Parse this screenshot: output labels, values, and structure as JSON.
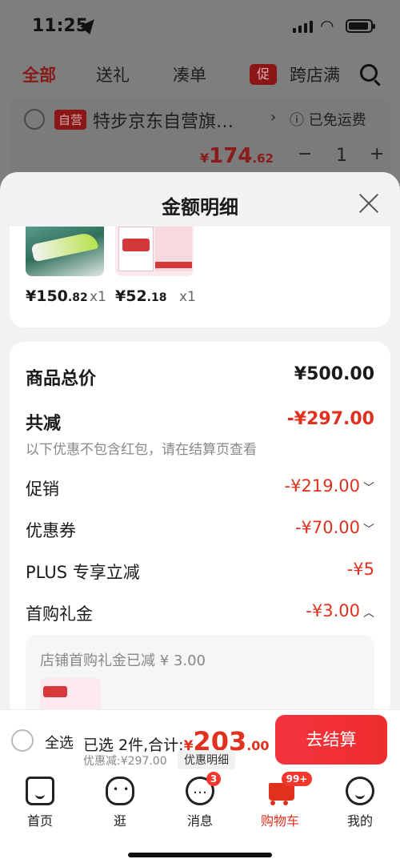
{
  "status": {
    "time": "11:25"
  },
  "bg_tabs": [
    "全部",
    "送礼",
    "凑单",
    "跨店满"
  ],
  "bg_promo_tag": "促",
  "bg_store": {
    "self_label": "自营",
    "name": "特步京东自营旗…",
    "free_shipping": "已免运费",
    "price_yen": "¥",
    "price_int": "174",
    "price_dec": ".62",
    "qty": "1",
    "minus": "−",
    "plus": "+"
  },
  "sheet": {
    "title": "金额明细",
    "products": [
      {
        "price_int": "¥150",
        "price_dec": ".82",
        "qty": "x1"
      },
      {
        "price_int": "¥52",
        "price_dec": ".18",
        "qty": "x1"
      }
    ],
    "rows": {
      "total_label": "商品总价",
      "total_value": "¥500.00",
      "reduce_label": "共减",
      "reduce_value": "-¥297.00",
      "note": "以下优惠不包含红包，请在结算页查看",
      "promo_label": "促销",
      "promo_value": "-¥219.00",
      "coupon_label": "优惠券",
      "coupon_value": "-¥70.00",
      "plus_label": "PLUS 专享立减",
      "plus_value": "-¥5",
      "first_label": "首购礼金",
      "first_value": "-¥3.00"
    },
    "sub_text": "店铺首购礼金已减 ¥ 3.00"
  },
  "checkout": {
    "select_all": "全选",
    "summary_prefix": "已选 2件,合计:",
    "amount_yen": "¥",
    "amount_int": "203",
    "amount_dec": ".00",
    "discount": "优惠减:¥297.00",
    "detail_btn": "优惠明细",
    "button": "去结算"
  },
  "tabbar": {
    "items": [
      "首页",
      "逛",
      "消息",
      "购物车",
      "我的"
    ],
    "msg_badge": "3",
    "cart_badge": "99+"
  },
  "colors": {
    "accent": "#e0301e",
    "checkout_btn": "#f5333f"
  }
}
